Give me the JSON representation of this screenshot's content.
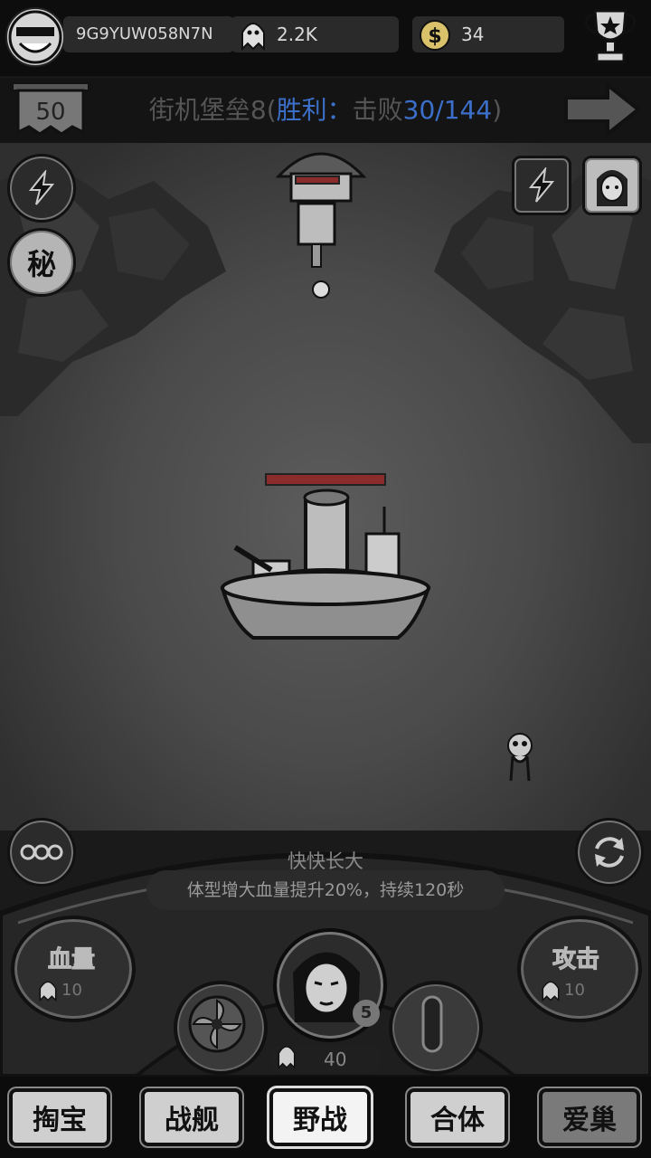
{
  "player": {
    "id": "9G9YUW058N7N",
    "ghosts": "2.2K",
    "coins": "34"
  },
  "stage": {
    "level": "50",
    "name": "街机堡垒8",
    "paren_open": "(",
    "win_label": "胜利：",
    "goal_text": "击败",
    "progress": "30/144",
    "paren_close": ")"
  },
  "side_buttons": {
    "secret_label": "秘"
  },
  "buff": {
    "title": "快快长大",
    "description": "体型增大血量提升20%，持续120秒"
  },
  "upgrades": {
    "hp_label": "血量",
    "hp_cost": "10",
    "attack_label": "攻击",
    "attack_cost": "10"
  },
  "hero": {
    "level_badge": "5",
    "cost": "40"
  },
  "tabs": [
    "掏宝",
    "战舰",
    "野战",
    "合体",
    "爱巢"
  ],
  "active_tab": "野战",
  "colors": {
    "win_blue": "#3c6fc9",
    "hp_red": "#8a2c2c"
  }
}
